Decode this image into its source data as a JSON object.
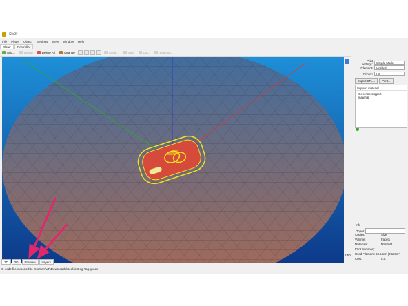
{
  "window": {
    "title": "Slic3r"
  },
  "menu": [
    "File",
    "Plater",
    "Object",
    "Settings",
    "View",
    "Window",
    "Help"
  ],
  "tabs": [
    "Plater",
    "Controller"
  ],
  "toolbar": {
    "add": "Add...",
    "delete": "Delete",
    "delete_all": "Delete All",
    "arrange": "Arrange",
    "scale": "Scale...",
    "split": "Split",
    "cut": "Cut...",
    "settings": "Settings..."
  },
  "viewport": {
    "zoom_value": "2.50"
  },
  "view_tabs": [
    "3D",
    "2D",
    "Preview",
    "Layers"
  ],
  "status_bar": "G-code file exported to C:\\Users\\JF\\Downloads\\Seekle Dog Tag.gcode",
  "right_panel": {
    "print_settings_label": "Print settings:",
    "print_settings_value": "Simple Mode",
    "filament_label": "Filament:",
    "filament_value": "Untitled",
    "printer_label": "Printer:",
    "printer_value": "H2",
    "export_stl": "Export STL...",
    "print": "Print...",
    "support_material_header": "Support material",
    "generate_support": "Generate support material:",
    "info_header": "Info",
    "object_label": "Object",
    "info_rows": [
      {
        "k1": "Copies:",
        "v1": "",
        "k2": "Size",
        "v2": ""
      },
      {
        "k1": "Volume:",
        "v1": "",
        "k2": "Facets",
        "v2": ""
      },
      {
        "k1": "Materials:",
        "v1": "",
        "k2": "Manifold",
        "v2": ""
      }
    ],
    "print_summary": "Print Summary",
    "used_filament": "Used Filament: 60.54cm (2.18cm³)",
    "cost_label": "Cost:",
    "cost_value": "n.a."
  },
  "colors": {
    "axis_x": "#d23c3c",
    "axis_y": "#2fa82f",
    "axis_z": "#3333cc",
    "bed_top": "#3e6da0",
    "bed_bottom": "#a86a55",
    "object_outline": "#f3e21a",
    "object_fill": "#d64a3c",
    "annotation_arrow": "#e0286a"
  }
}
